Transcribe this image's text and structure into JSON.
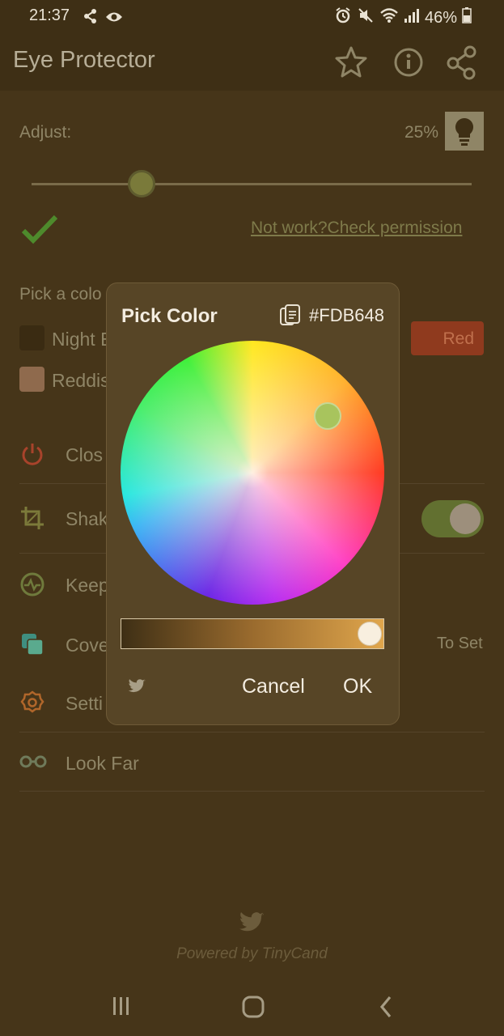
{
  "status_bar": {
    "time": "21:37",
    "battery": "46%"
  },
  "app_bar": {
    "title": "Eye Protector",
    "icons": [
      "star-icon",
      "info-icon",
      "share-icon"
    ]
  },
  "adjust": {
    "label": "Adjust:",
    "percent": "25%",
    "slider_value": 0.25
  },
  "permission_link": "Not work?Check permission",
  "pick_color": {
    "label": "Pick a colo",
    "options": [
      {
        "label": "Night E",
        "color": "#3a2b12"
      },
      {
        "label": "Reddis",
        "color": "#8f6a4d"
      }
    ],
    "red_button": "Red"
  },
  "menu": [
    {
      "label": "Clos",
      "icon": "power-icon",
      "icon_color": "#a8432b"
    },
    {
      "label": "Shak",
      "icon": "crop-icon",
      "icon_color": "#7c7a3a",
      "toggle_on": true
    },
    {
      "label": "Keep",
      "icon": "activity-icon",
      "icon_color": "#6f7a3c"
    },
    {
      "label": "Cove",
      "icon": "layers-icon",
      "icon_color": "#3f8f80",
      "right_text": "To Set"
    },
    {
      "label": "Setti",
      "icon": "gear-icon",
      "icon_color": "#b0662a"
    },
    {
      "label": "Look Far",
      "icon": "glasses-icon",
      "icon_color": "#6f7a5a"
    }
  ],
  "footer": {
    "powered_by": "Powered by TinyCand"
  },
  "dialog": {
    "title": "Pick Color",
    "hex_value": "#FDB648",
    "brightness": 1.0,
    "cancel_label": "Cancel",
    "ok_label": "OK"
  },
  "colors": {
    "background": "#463519",
    "accent_green": "#4e8a2c",
    "dialog_bg": "#574526"
  }
}
